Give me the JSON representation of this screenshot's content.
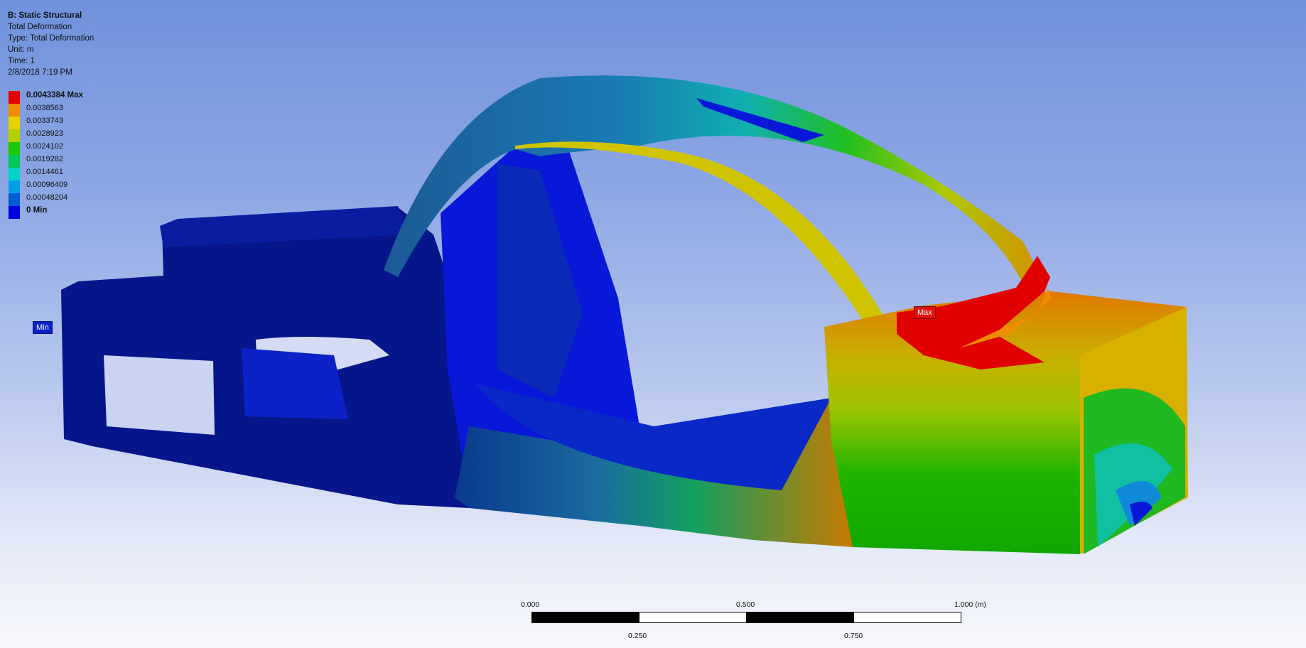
{
  "info": {
    "title": "B: Static Structural",
    "result_name": "Total Deformation",
    "type": "Type: Total Deformation",
    "unit": "Unit: m",
    "time": "Time: 1",
    "date": "2/8/2018 7:19 PM"
  },
  "legend": {
    "entries": [
      {
        "label": "0.0043384 Max",
        "color": "#e60000",
        "bold": true
      },
      {
        "label": "0.0038563",
        "color": "#f08c00",
        "bold": false
      },
      {
        "label": "0.0033743",
        "color": "#e6d200",
        "bold": false
      },
      {
        "label": "0.0028923",
        "color": "#b4d200",
        "bold": false
      },
      {
        "label": "0.0024102",
        "color": "#1ec800",
        "bold": false
      },
      {
        "label": "0.0019282",
        "color": "#00c85a",
        "bold": false
      },
      {
        "label": "0.0014461",
        "color": "#00d2c8",
        "bold": false
      },
      {
        "label": "0.00096409",
        "color": "#009ee6",
        "bold": false
      },
      {
        "label": "0.00048204",
        "color": "#005ad2",
        "bold": false
      },
      {
        "label": "0 Min",
        "color": "#0000e6",
        "bold": true
      }
    ]
  },
  "probes": {
    "min_label": "Min",
    "max_label": "Max"
  },
  "scale_bar": {
    "top_labels": [
      "0.000",
      "0.500",
      "1.000 (m)"
    ],
    "bottom_labels": [
      "0.250",
      "0.750"
    ]
  },
  "colors": {
    "background_top": "#6f92dc",
    "background_bottom": "#f7f8fc",
    "max_color": "#e60000",
    "min_color": "#0000e6"
  }
}
